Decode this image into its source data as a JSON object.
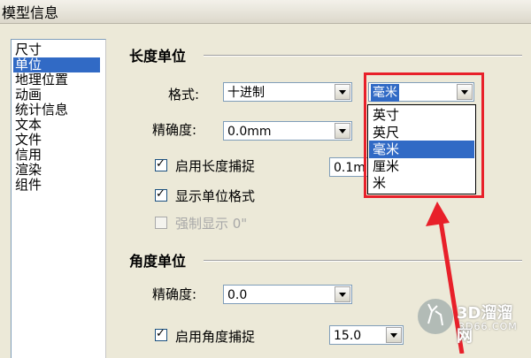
{
  "window": {
    "title": "模型信息"
  },
  "sidebar": {
    "items": [
      {
        "label": "尺寸",
        "selected": false
      },
      {
        "label": "单位",
        "selected": true
      },
      {
        "label": "地理位置",
        "selected": false
      },
      {
        "label": "动画",
        "selected": false
      },
      {
        "label": "统计信息",
        "selected": false
      },
      {
        "label": "文本",
        "selected": false
      },
      {
        "label": "文件",
        "selected": false
      },
      {
        "label": "信用",
        "selected": false
      },
      {
        "label": "渲染",
        "selected": false
      },
      {
        "label": "组件",
        "selected": false
      }
    ]
  },
  "length_units": {
    "title": "长度单位",
    "format_label": "格式:",
    "format_value": "十进制",
    "unit_value": "毫米",
    "unit_options": [
      "英寸",
      "英尺",
      "毫米",
      "厘米",
      "米"
    ],
    "unit_selected_index": 2,
    "precision_label": "精确度:",
    "precision_value": "0.0mm",
    "enable_snap_label": "启用长度捕捉",
    "enable_snap_checked": true,
    "snap_value": "0.1m",
    "show_format_label": "显示单位格式",
    "show_format_checked": true,
    "force_display_label": "强制显示 0\"",
    "force_display_checked": false,
    "force_display_enabled": false
  },
  "angle_units": {
    "title": "角度单位",
    "precision_label": "精确度:",
    "precision_value": "0.0",
    "enable_snap_label": "启用角度捕捉",
    "enable_snap_checked": true,
    "snap_value": "15.0"
  },
  "watermark": {
    "brand": "3D溜溜网",
    "url": "3D66.COM"
  },
  "colors": {
    "selection": "#316ac5",
    "annotation": "#e8202a",
    "dialog_bg": "#ece9d8"
  }
}
